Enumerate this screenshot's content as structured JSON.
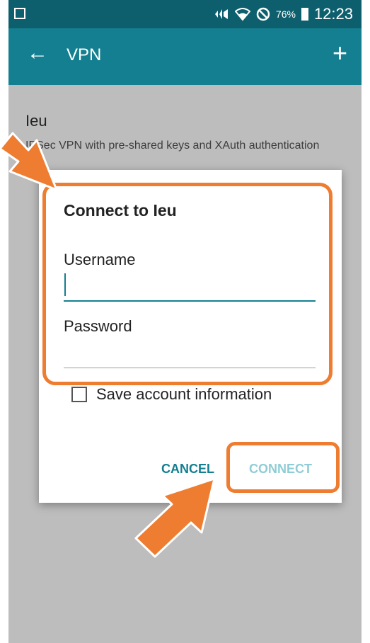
{
  "status_bar": {
    "battery": "76%",
    "time": "12:23",
    "icons": [
      "gallery-notification-icon",
      "signal-icon",
      "wifi-icon",
      "do-not-disturb-icon",
      "battery-icon"
    ]
  },
  "app_bar": {
    "title": "VPN",
    "back_icon": "arrow-left-icon",
    "add_icon": "plus-icon",
    "back_glyph": "←",
    "add_glyph": "+"
  },
  "vpn_profile": {
    "name": "Ieu",
    "description": "IPSec VPN with pre-shared keys and XAuth authentication"
  },
  "dialog": {
    "title": "Connect to Ieu",
    "username_label": "Username",
    "username_value": "",
    "password_label": "Password",
    "password_value": "",
    "checkbox_label": "Save account information",
    "checkbox_checked": false,
    "cancel_label": "CANCEL",
    "connect_label": "CONNECT"
  },
  "colors": {
    "status_bar": "#0e5f6e",
    "app_bar": "#137f90",
    "accent": "#137f90",
    "connect_disabled": "#8fcdd6",
    "annotation": "#ee7d31",
    "scrim": "#bdbdbd"
  }
}
